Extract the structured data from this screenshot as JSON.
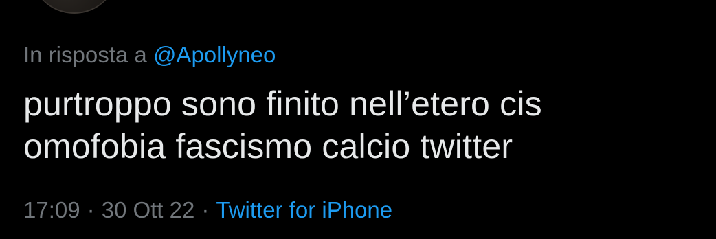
{
  "tweet": {
    "reply_prefix": "In risposta a",
    "reply_to": "@Apollyneo",
    "text_line1": "purtroppo sono finito nell’etero cis",
    "text_line2": "omofobia fascismo calcio twitter",
    "time": "17:09",
    "separator": "·",
    "date": "30 Ott 22",
    "source": "Twitter for iPhone"
  },
  "colors": {
    "background": "#000000",
    "text_primary": "#e7e9ea",
    "text_secondary": "#71767b",
    "accent": "#1d9bf0"
  }
}
